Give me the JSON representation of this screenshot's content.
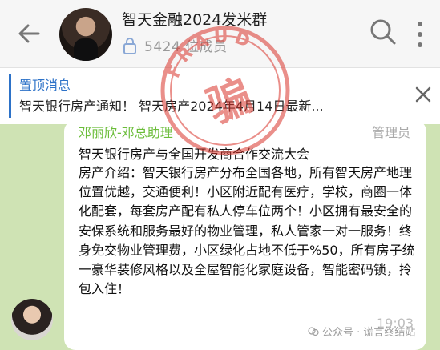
{
  "header": {
    "title": "智天金融2024发米群",
    "member_count": "5424 位成员",
    "back_icon": "arrow-left-icon",
    "search_icon": "search-icon",
    "more_icon": "more-vertical-icon"
  },
  "stamp": {
    "top_text": "FRAUD",
    "center_text": "骗",
    "color": "#d9342b"
  },
  "pinned": {
    "label": "置顶消息",
    "text": "智天银行房产通知！ 智天房产2024年4月14日最新...",
    "accent_color": "#2d72c8"
  },
  "message": {
    "sender": "邓丽欣-邓总助理",
    "badge": "管理员",
    "title": "智天银行房产与全国开发商合作交流大会",
    "body": "房产介绍：智天银行房产分布全国各地，所有智天房产地理位置优越，交通便利！小区附近配有医疗，学校，商圈一体化配套，每套房产配有私人停车位两个！小区拥有最安全的安保系统和服务最好的物业管理，私人管家一对一服务！终身免交物业管理费，小区绿化占地不低于%50，所有房子统一豪华装修风格以及全屋智能化家庭设备，智能密码锁，拎包入住！",
    "time": "19:03",
    "sender_color": "#6bbd3a"
  },
  "watermark": "公众号 · 谎言终结站"
}
